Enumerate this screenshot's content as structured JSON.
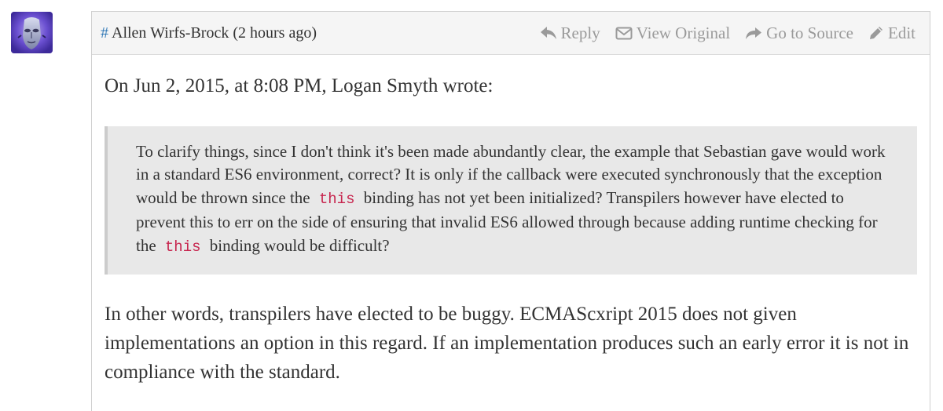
{
  "post": {
    "hash": "#",
    "author": "Allen Wirfs-Brock",
    "time": "(2 hours ago)"
  },
  "actions": {
    "reply": "Reply",
    "view_original": "View Original",
    "go_to_source": "Go to Source",
    "edit": "Edit"
  },
  "body": {
    "intro": "On Jun 2, 2015, at 8:08 PM, Logan Smyth wrote:",
    "quote": {
      "part1": "To clarify things, since I don't think it's been made abundantly clear, the example that Sebastian gave would work in a standard ES6 environment, correct? It is only if the callback were executed synchronously that the exception would be thrown since the",
      "code1": "this",
      "part2": "binding has not yet been initialized? Transpilers however have elected to prevent this to err on the side of ensuring that invalid ES6 allowed through because adding runtime checking for the",
      "code2": "this",
      "part3": "binding would be difficult?"
    },
    "reply_text": "In other words, transpilers have elected to be buggy. ECMAScxript 2015 does not given implementations an option in this regard. If an implementation produces such an early error it is not in compliance with the standard."
  },
  "icons": {
    "avatar": "robot-face-avatar",
    "reply": "reply-arrow-icon",
    "view_original": "envelope-icon",
    "go_to_source": "share-arrow-icon",
    "edit": "pencil-icon"
  },
  "colors": {
    "link": "#337ab7",
    "action_gray": "#9a9a9a",
    "code": "#c7254e",
    "quote_bg": "#e8e8e8"
  }
}
